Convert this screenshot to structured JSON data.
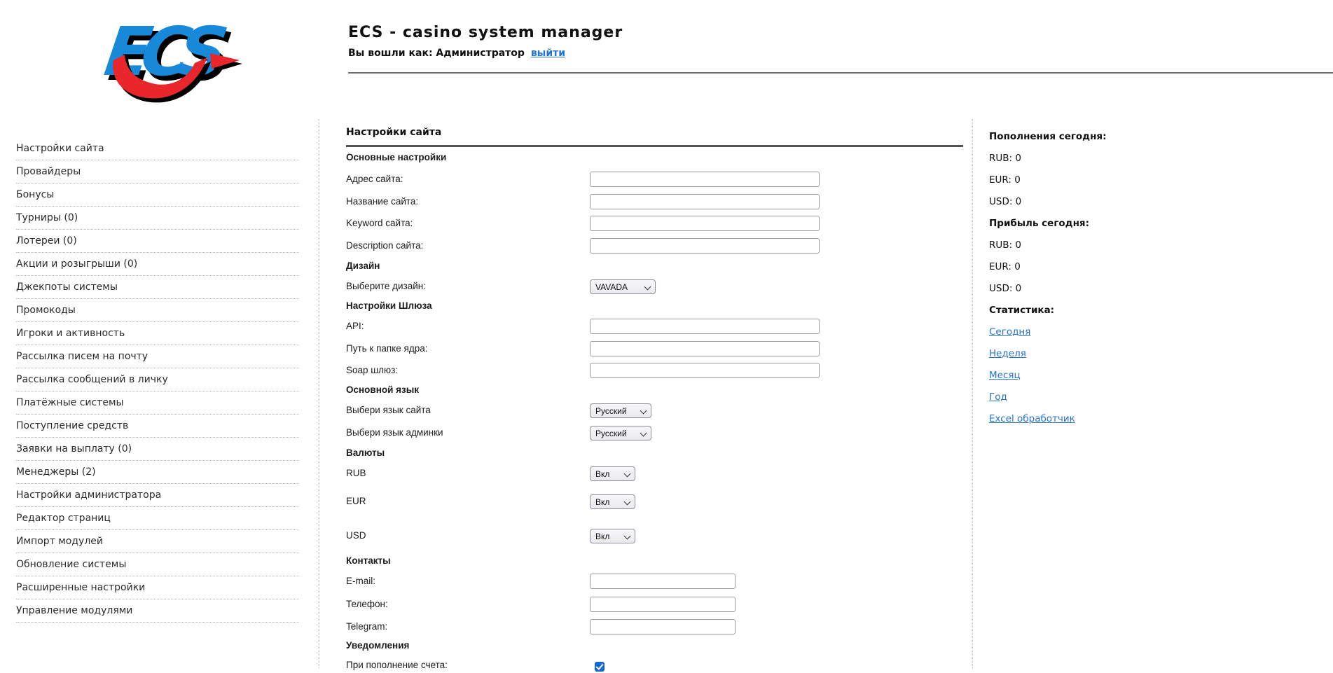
{
  "header": {
    "logo_text": "ECS",
    "title": "ECS - casino system manager",
    "login_status": "Вы вошли как: Администратор",
    "logout_label": "выйти"
  },
  "sidebar": {
    "items": [
      "Настройки сайта",
      "Провайдеры",
      "Бонусы",
      "Турниры (0)",
      "Лотереи (0)",
      "Акции и розыгрыши (0)",
      "Джекпоты системы",
      "Промокоды",
      "Игроки и активность",
      "Рассылка писем на почту",
      "Рассылка сообщений в личку",
      "Платёжные системы",
      "Поступление средств",
      "Заявки на выплату (0)",
      "Менеджеры (2)",
      "Настройки администратора",
      "Редактор страниц",
      "Импорт модулей",
      "Обновление системы",
      "Расширенные настройки",
      "Управление модулями"
    ]
  },
  "main": {
    "title": "Настройки сайта",
    "sections": {
      "basic": "Основные настройки",
      "design": "Дизайн",
      "gateway": "Настройки Шлюза",
      "language": "Основной язык",
      "currencies": "Валюты",
      "contacts": "Контакты",
      "notifications": "Уведомления"
    },
    "fields": {
      "site_address": {
        "label": "Адрес сайта:",
        "value": ""
      },
      "site_name": {
        "label": "Название сайта:",
        "value": ""
      },
      "site_keyword": {
        "label": "Keyword сайта:",
        "value": ""
      },
      "site_description": {
        "label": "Description сайта:",
        "value": ""
      },
      "design_select": {
        "label": "Выберите дизайн:",
        "value": "VAVADA"
      },
      "api": {
        "label": "API:",
        "value": ""
      },
      "core_path": {
        "label": "Путь к папке ядра:",
        "value": ""
      },
      "soap_gateway": {
        "label": "Soap шлюз:",
        "value": ""
      },
      "site_lang": {
        "label": "Выбери язык сайта",
        "value": "Русский"
      },
      "admin_lang": {
        "label": "Выбери язык админки",
        "value": "Русский"
      },
      "rub": {
        "label": "RUB",
        "value": "Вкл"
      },
      "eur": {
        "label": "EUR",
        "value": "Вкл"
      },
      "usd": {
        "label": "USD",
        "value": "Вкл"
      },
      "email": {
        "label": "E-mail:",
        "value": ""
      },
      "phone": {
        "label": "Телефон:",
        "value": ""
      },
      "telegram": {
        "label": "Telegram:",
        "value": ""
      },
      "deposit_notify": {
        "label": "При пополнение счета:",
        "checked": true
      }
    }
  },
  "stats": {
    "deposits_title": "Пополнения сегодня:",
    "deposits": [
      "RUB: 0",
      "EUR: 0",
      "USD: 0"
    ],
    "profit_title": "Прибыль сегодня:",
    "profit": [
      "RUB: 0",
      "EUR: 0",
      "USD: 0"
    ],
    "stats_title": "Статистика:",
    "links": [
      "Сегодня",
      "Неделя",
      "Месяц",
      "Год",
      "Excel обработчик"
    ]
  },
  "colors": {
    "logo_blue": "#1789d8",
    "logo_red": "#e8262b",
    "link_blue": "#2673d2",
    "checkbox_blue": "#1567d3",
    "rule_dark": "#545454"
  }
}
